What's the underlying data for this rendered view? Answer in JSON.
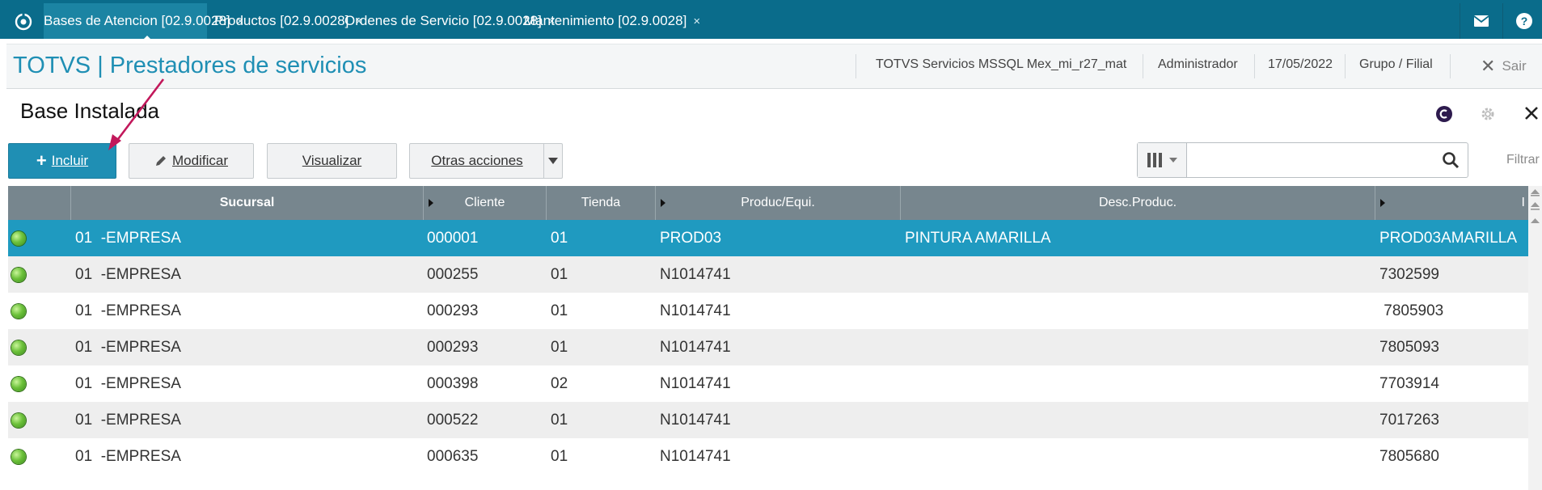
{
  "tabs": [
    {
      "label": "Bases de Atencion [02.9.0028]",
      "close": "×"
    },
    {
      "label": "Productos [02.9.0028]",
      "close": "×"
    },
    {
      "label": "Ordenes de Servicio [02.9.0028]",
      "close": "×"
    },
    {
      "label": "Mantenimiento [02.9.0028]",
      "close": "×"
    }
  ],
  "header": {
    "app_title": "TOTVS | Prestadores de servicios",
    "environment": "TOTVS Servicios MSSQL Mex_mi_r27_mat",
    "user": "Administrador",
    "date": "17/05/2022",
    "company": "Grupo / Filial",
    "exit_label": "Sair"
  },
  "page": {
    "title": "Base Instalada"
  },
  "toolbar": {
    "include_label": "Incluir",
    "modify_label": "Modificar",
    "view_label": "Visualizar",
    "more_actions_label": "Otras acciones"
  },
  "search": {
    "value": "",
    "filter_label": "Filtrar"
  },
  "grid": {
    "columns": [
      "Sucursal",
      "Cliente",
      "Tienda",
      "Produc/Equi.",
      "Desc.Produc.",
      "I"
    ],
    "rows": [
      {
        "sucursal": "01  -EMPRESA",
        "cliente": "000001",
        "tienda": "01",
        "produc": "PROD03",
        "desc": "PINTURA AMARILLA",
        "id": "PROD03AMARILLA"
      },
      {
        "sucursal": "01  -EMPRESA",
        "cliente": "000255",
        "tienda": "01",
        "produc": "N1014741",
        "desc": "",
        "id": "7302599"
      },
      {
        "sucursal": "01  -EMPRESA",
        "cliente": "000293",
        "tienda": "01",
        "produc": "N1014741",
        "desc": "",
        "id": " 7805903"
      },
      {
        "sucursal": "01  -EMPRESA",
        "cliente": "000293",
        "tienda": "01",
        "produc": "N1014741",
        "desc": "",
        "id": "7805093"
      },
      {
        "sucursal": "01  -EMPRESA",
        "cliente": "000398",
        "tienda": "02",
        "produc": "N1014741",
        "desc": "",
        "id": "7703914"
      },
      {
        "sucursal": "01  -EMPRESA",
        "cliente": "000522",
        "tienda": "01",
        "produc": "N1014741",
        "desc": "",
        "id": "7017263"
      },
      {
        "sucursal": "01  -EMPRESA",
        "cliente": "000635",
        "tienda": "01",
        "produc": "N1014741",
        "desc": "",
        "id": "7805680"
      }
    ]
  },
  "colors": {
    "topbar": "#0a6c8b",
    "accent": "#1f8fb4",
    "selected_row": "#1f9ac0",
    "status_ok": "#6cc13a",
    "annotation": "#c2185b"
  },
  "icons": {
    "home": "refresh-icon",
    "mail": "mail-icon",
    "help": "help-icon",
    "close": "close-icon",
    "settings": "gear-icon",
    "search": "search-icon",
    "columns": "columns-icon",
    "status": "status-led-icon"
  }
}
